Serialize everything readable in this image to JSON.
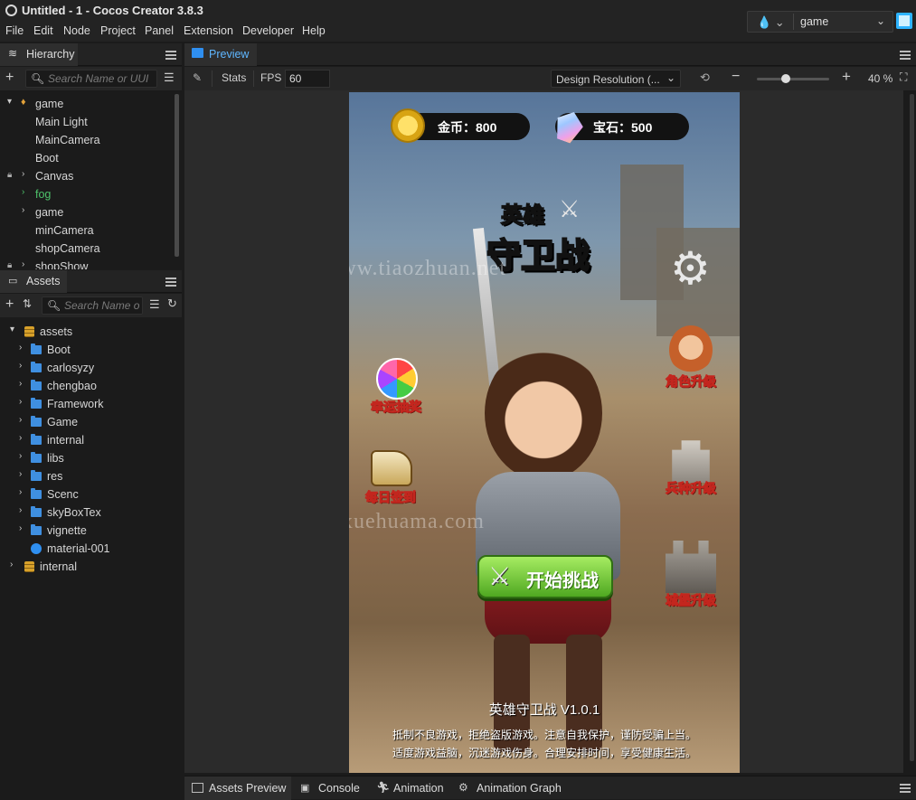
{
  "window": {
    "title": "Untitled - 1 - Cocos Creator 3.8.3"
  },
  "menu": [
    "File",
    "Edit",
    "Node",
    "Project",
    "Panel",
    "Extension",
    "Developer",
    "Help"
  ],
  "scene_selector": {
    "value": "game"
  },
  "hierarchy": {
    "title": "Hierarchy",
    "search_placeholder": "Search Name or UUI",
    "nodes": [
      {
        "label": "game"
      },
      {
        "label": "Main Light"
      },
      {
        "label": "MainCamera"
      },
      {
        "label": "Boot"
      },
      {
        "label": "Canvas"
      },
      {
        "label": "fog"
      },
      {
        "label": "game"
      },
      {
        "label": "minCamera"
      },
      {
        "label": "shopCamera"
      },
      {
        "label": "shopShow"
      }
    ]
  },
  "assets": {
    "title": "Assets",
    "search_placeholder": "Search Name o",
    "items": [
      {
        "label": "assets"
      },
      {
        "label": "Boot"
      },
      {
        "label": "carlosyzy"
      },
      {
        "label": "chengbao"
      },
      {
        "label": "Framework"
      },
      {
        "label": "Game"
      },
      {
        "label": "internal"
      },
      {
        "label": "libs"
      },
      {
        "label": "res"
      },
      {
        "label": "Scenc"
      },
      {
        "label": "skyBoxTex"
      },
      {
        "label": "vignette"
      },
      {
        "label": "material-001"
      },
      {
        "label": "internal"
      }
    ]
  },
  "preview": {
    "tab": "Preview",
    "stats_label": "Stats",
    "fps_label": "FPS",
    "fps_value": "60",
    "resolution": "Design Resolution (...",
    "zoom": "40 %",
    "zoom_level": 0.4
  },
  "game": {
    "coins": "金币：800",
    "gems": "宝石：500",
    "title_top": "英雄",
    "title_bottom": "守卫战",
    "buttons": {
      "lucky_draw": "幸运抽奖",
      "daily_signin": "每日签到",
      "hero_upgrade": "角色升级",
      "troop_upgrade": "兵种升级",
      "castle_upgrade": "城堡升级",
      "start": "开始挑战"
    },
    "version": "英雄守卫战 V1.0.1",
    "notice_line1": "抵制不良游戏，拒绝盗版游戏。注意自我保护，谨防受骗上当。",
    "notice_line2": "适度游戏益脑，沉迷游戏伤身。合理安排时间，享受健康生活。",
    "watermark1": "www.tiaozhuan.net",
    "watermark2": "u.xuehuama.com"
  },
  "bottom_tabs": [
    "Assets Preview",
    "Console",
    "Animation",
    "Animation Graph"
  ],
  "colors": {
    "accent": "#2db3ff",
    "folder": "#3f8fe0",
    "selected_node": "#4ec36b"
  }
}
